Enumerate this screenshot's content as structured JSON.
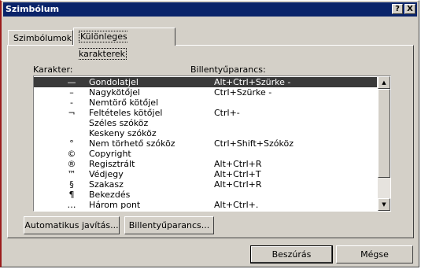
{
  "window": {
    "title": "Szimbólum",
    "help_glyph": "?",
    "close_glyph": "X"
  },
  "tabs": [
    {
      "label": "Szimbólumok",
      "active": false
    },
    {
      "label": "Különleges karakterek",
      "active": true
    }
  ],
  "list": {
    "header_char": "Karakter:",
    "header_key": "Billentyűparancs:",
    "rows": [
      {
        "sym": "—",
        "name": "Gondolatjel",
        "key": "Alt+Ctrl+Szürke -",
        "selected": true
      },
      {
        "sym": "–",
        "name": "Nagykötőjel",
        "key": "Ctrl+Szürke -"
      },
      {
        "sym": "-",
        "name": "Nemtörő kötőjel",
        "key": ""
      },
      {
        "sym": "¬",
        "name": "Feltételes kötőjel",
        "key": "Ctrl+-"
      },
      {
        "sym": "",
        "name": "Széles szóköz",
        "key": ""
      },
      {
        "sym": "",
        "name": "Keskeny szóköz",
        "key": ""
      },
      {
        "sym": "°",
        "name": "Nem törhető szóköz",
        "key": "Ctrl+Shift+Szóköz"
      },
      {
        "sym": "©",
        "name": "Copyright",
        "key": ""
      },
      {
        "sym": "®",
        "name": "Regisztrált",
        "key": "Alt+Ctrl+R"
      },
      {
        "sym": "™",
        "name": "Védjegy",
        "key": "Alt+Ctrl+T"
      },
      {
        "sym": "§",
        "name": "Szakasz",
        "key": "Alt+Ctrl+R"
      },
      {
        "sym": "¶",
        "name": "Bekezdés",
        "key": ""
      },
      {
        "sym": "…",
        "name": "Három pont",
        "key": "Alt+Ctrl+."
      }
    ]
  },
  "buttons": {
    "autocorrect": "Automatikus javítás...",
    "shortcut": "Billentyűparancs...",
    "insert": "Beszúrás",
    "cancel": "Mégse"
  },
  "colors": {
    "titlebar": "#0a246a",
    "selection": "#3a3a3a",
    "frame_accent": "#9b1c1c"
  }
}
